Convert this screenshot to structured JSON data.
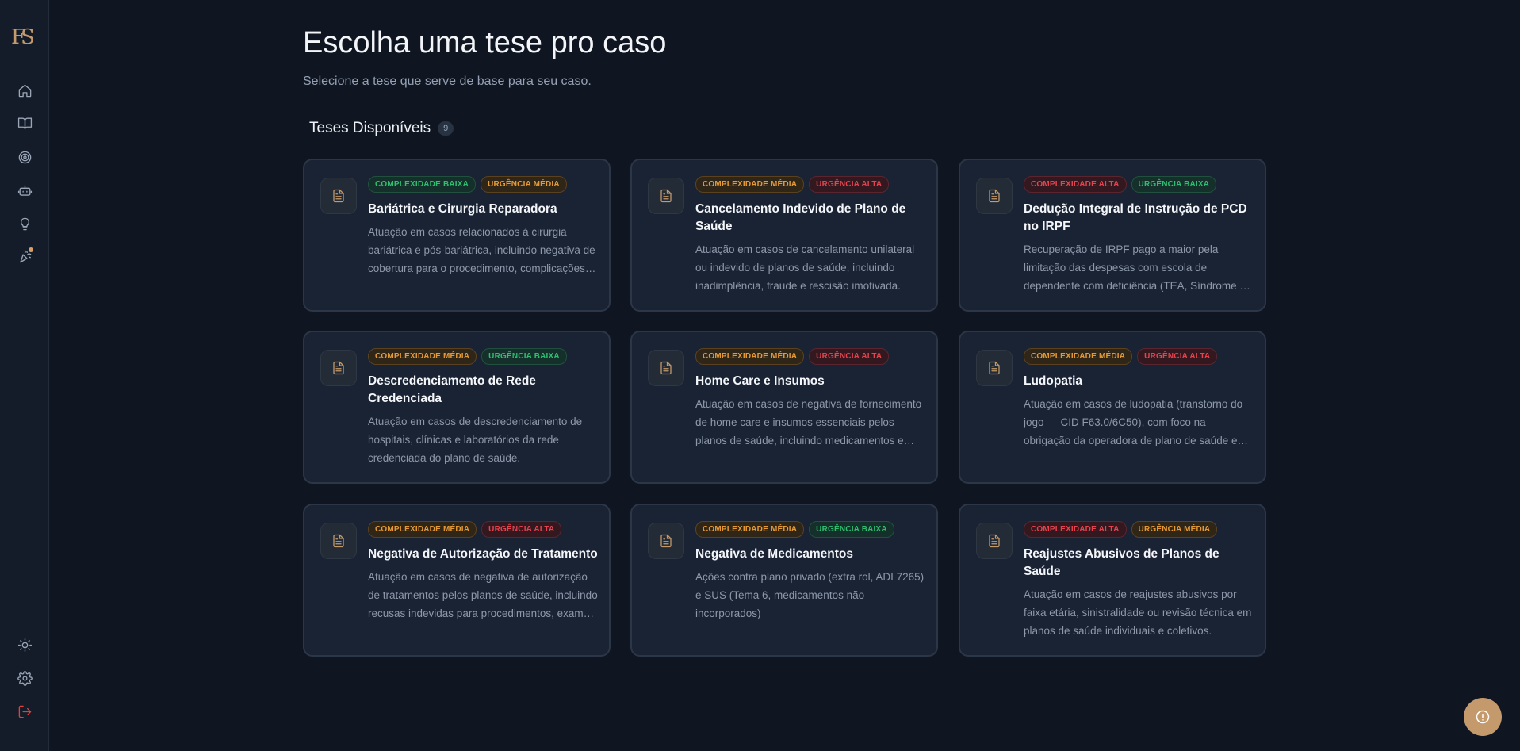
{
  "brand": {
    "logo_text": "FS"
  },
  "header": {
    "title": "Escolha uma tese pro caso",
    "subtitle": "Selecione a tese que serve de base para seu caso."
  },
  "section": {
    "title": "Teses Disponíveis",
    "count": "9"
  },
  "theses": [
    {
      "badges": [
        {
          "label": "COMPLEXIDADE BAIXA",
          "level": "baixa"
        },
        {
          "label": "URGÊNCIA MÉDIA",
          "level": "media"
        }
      ],
      "title": "Bariátrica e Cirurgia Reparadora",
      "description": "Atuação em casos relacionados à cirurgia bariátrica e pós-bariátrica, incluindo negativa de cobertura para o procedimento, complicações e cirurgias reparadoras."
    },
    {
      "badges": [
        {
          "label": "COMPLEXIDADE MÉDIA",
          "level": "media"
        },
        {
          "label": "URGÊNCIA ALTA",
          "level": "alta"
        }
      ],
      "title": "Cancelamento Indevido de Plano de Saúde",
      "description": "Atuação em casos de cancelamento unilateral ou indevido de planos de saúde, incluindo inadimplência, fraude e rescisão imotivada."
    },
    {
      "badges": [
        {
          "label": "COMPLEXIDADE ALTA",
          "level": "alta"
        },
        {
          "label": "URGÊNCIA BAIXA",
          "level": "baixa"
        }
      ],
      "title": "Dedução Integral de Instrução de PCD no IRPF",
      "description": "Recuperação de IRPF pago a maior pela limitação das despesas com escola de dependente com deficiência (TEA, Síndrome de Down e outras)."
    },
    {
      "badges": [
        {
          "label": "COMPLEXIDADE MÉDIA",
          "level": "media"
        },
        {
          "label": "URGÊNCIA BAIXA",
          "level": "baixa"
        }
      ],
      "title": "Descredenciamento de Rede Credenciada",
      "description": "Atuação em casos de descredenciamento de hospitais, clínicas e laboratórios da rede credenciada do plano de saúde."
    },
    {
      "badges": [
        {
          "label": "COMPLEXIDADE MÉDIA",
          "level": "media"
        },
        {
          "label": "URGÊNCIA ALTA",
          "level": "alta"
        }
      ],
      "title": "Home Care e Insumos",
      "description": "Atuação em casos de negativa de fornecimento de home care e insumos essenciais pelos planos de saúde, incluindo medicamentos e equipamentos."
    },
    {
      "badges": [
        {
          "label": "COMPLEXIDADE MÉDIA",
          "level": "media"
        },
        {
          "label": "URGÊNCIA ALTA",
          "level": "alta"
        }
      ],
      "title": "Ludopatia",
      "description": "Atuação em casos de ludopatia (transtorno do jogo — CID F63.0/6C50), com foco na obrigação da operadora de plano de saúde em cobrir o tratamento."
    },
    {
      "badges": [
        {
          "label": "COMPLEXIDADE MÉDIA",
          "level": "media"
        },
        {
          "label": "URGÊNCIA ALTA",
          "level": "alta"
        }
      ],
      "title": "Negativa de Autorização de Tratamento",
      "description": "Atuação em casos de negativa de autorização de tratamentos pelos planos de saúde, incluindo recusas indevidas para procedimentos, exames e terapias."
    },
    {
      "badges": [
        {
          "label": "COMPLEXIDADE MÉDIA",
          "level": "media"
        },
        {
          "label": "URGÊNCIA BAIXA",
          "level": "baixa"
        }
      ],
      "title": "Negativa de Medicamentos",
      "description": "Ações contra plano privado (extra rol, ADI 7265) e SUS (Tema 6, medicamentos não incorporados)"
    },
    {
      "badges": [
        {
          "label": "COMPLEXIDADE ALTA",
          "level": "alta"
        },
        {
          "label": "URGÊNCIA MÉDIA",
          "level": "media"
        }
      ],
      "title": "Reajustes Abusivos de Planos de Saúde",
      "description": "Atuação em casos de reajustes abusivos por faixa etária, sinistralidade ou revisão técnica em planos de saúde individuais e coletivos."
    }
  ]
}
